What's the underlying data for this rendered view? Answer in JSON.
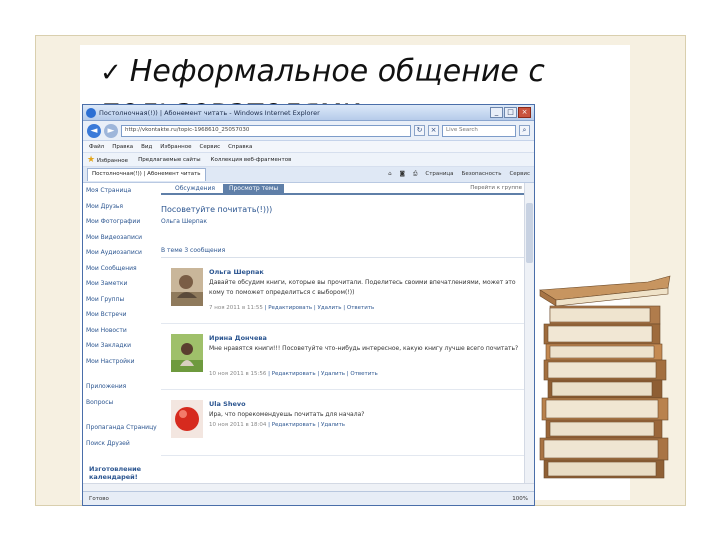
{
  "slide": {
    "title": "Неформальное общение с пользователями"
  },
  "browser": {
    "window_title": "Постолночная(!)) | Абонемент читать - Windows Internet Explorer",
    "url": "http://vkontakte.ru/topic-1968610_25057030",
    "search_placeholder": "Live Search",
    "menu": [
      "Файл",
      "Правка",
      "Вид",
      "Избранное",
      "Сервис",
      "Справка"
    ],
    "favorites_label": "Избранное",
    "favorites": [
      "Предлагаемые сайты",
      "Коллекция веб-фрагментов"
    ],
    "tab_label": "Постолночная(!)) | Абонемент читать",
    "tab_tools": [
      "Страница",
      "Безопасность",
      "Сервис"
    ],
    "status_text": "Готово",
    "zoom": "100%"
  },
  "sidebar": {
    "items": [
      "Моя Страница",
      "Мои Друзья",
      "Мои Фотографии",
      "Мои Видеозаписи",
      "Мои Аудиозаписи",
      "Мои Сообщения",
      "Мои Заметки",
      "Мои Группы",
      "Мои Встречи",
      "Мои Новости",
      "Мои Закладки",
      "Мои Настройки",
      "Приложения",
      "Вопросы"
    ],
    "extra": [
      "Пропаганда Страницу",
      "Поиск Друзей"
    ],
    "promo": "Изготовление календарей!"
  },
  "content": {
    "tabs": [
      "Обсуждения",
      "Просмотр темы"
    ],
    "tabs_right": "Перейти к группе",
    "thread_title": "Посоветуйте почитать(!)))",
    "thread_author": "Ольга Шерпак",
    "thread_count": "В теме 3 сообщения",
    "posts": [
      {
        "name": "Ольга Шерпак",
        "text": "Давайте обсудим книги, которые вы прочитали. Поделитесь своими впечатлениями, может это кому то поможет определиться с выбором(!))",
        "date": "7 ноя 2011 в 11:55",
        "actions": [
          "Редактировать",
          "Удалить",
          "Ответить"
        ]
      },
      {
        "name": "Ирина Дончева",
        "text": "Мне нравятся книги!!! Посоветуйте что-нибудь интересное, какую книгу лучше всего почитать?",
        "date": "10 ноя 2011 в 15:56",
        "actions": [
          "Редактировать",
          "Удалить",
          "Ответить"
        ]
      },
      {
        "name": "Ula Shevo",
        "text": "Ира, что порекомендуешь почитать для начала?",
        "date": "10 ноя 2011 в 18:04",
        "actions": [
          "Редактировать",
          "Удалить"
        ]
      }
    ]
  },
  "colors": {
    "link": "#2b5590",
    "tab_active": "#5f7fa8",
    "frame": "#f6f0e1"
  }
}
